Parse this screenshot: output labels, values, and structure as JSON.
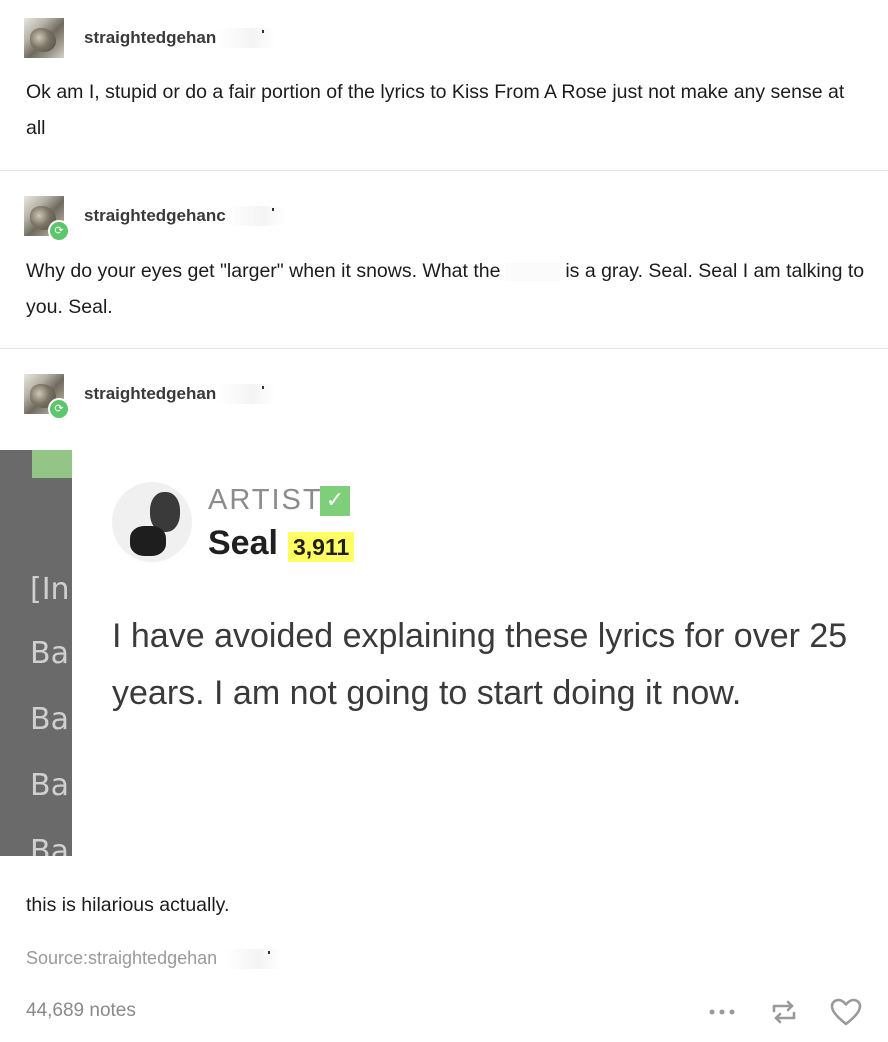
{
  "posts": [
    {
      "username": "straightedgehan",
      "text": "Ok am I, stupid or do a fair portion of the lyrics to Kiss From A Rose just not make any sense at all"
    },
    {
      "username": "straightedgehanc",
      "text_before": "Why do your eyes get \"larger\" when it snows. What the",
      "text_after": "is a gray. Seal. Seal I am talking to you. Seal."
    },
    {
      "username": "straightedgehan"
    }
  ],
  "embed": {
    "gray_lines": [
      "[In",
      "Ba",
      "Ba",
      "Ba",
      "Ba"
    ],
    "artist_label": "ARTIST",
    "artist_name": "Seal",
    "iq": "3,911",
    "quote": "I have avoided explaining these lyrics for over 25 years. I am not going to start doing it now."
  },
  "caption": "this is hilarious actually.",
  "source": "Source:straightedgehan",
  "notes": "44,689 notes",
  "icons": {
    "more": "more-dots-icon",
    "reblog": "reblog-icon",
    "like": "heart-icon"
  },
  "colors": {
    "reblog_green": "#5cc66b",
    "iq_yellow": "#ffff64",
    "verified_green": "#7fce79"
  }
}
